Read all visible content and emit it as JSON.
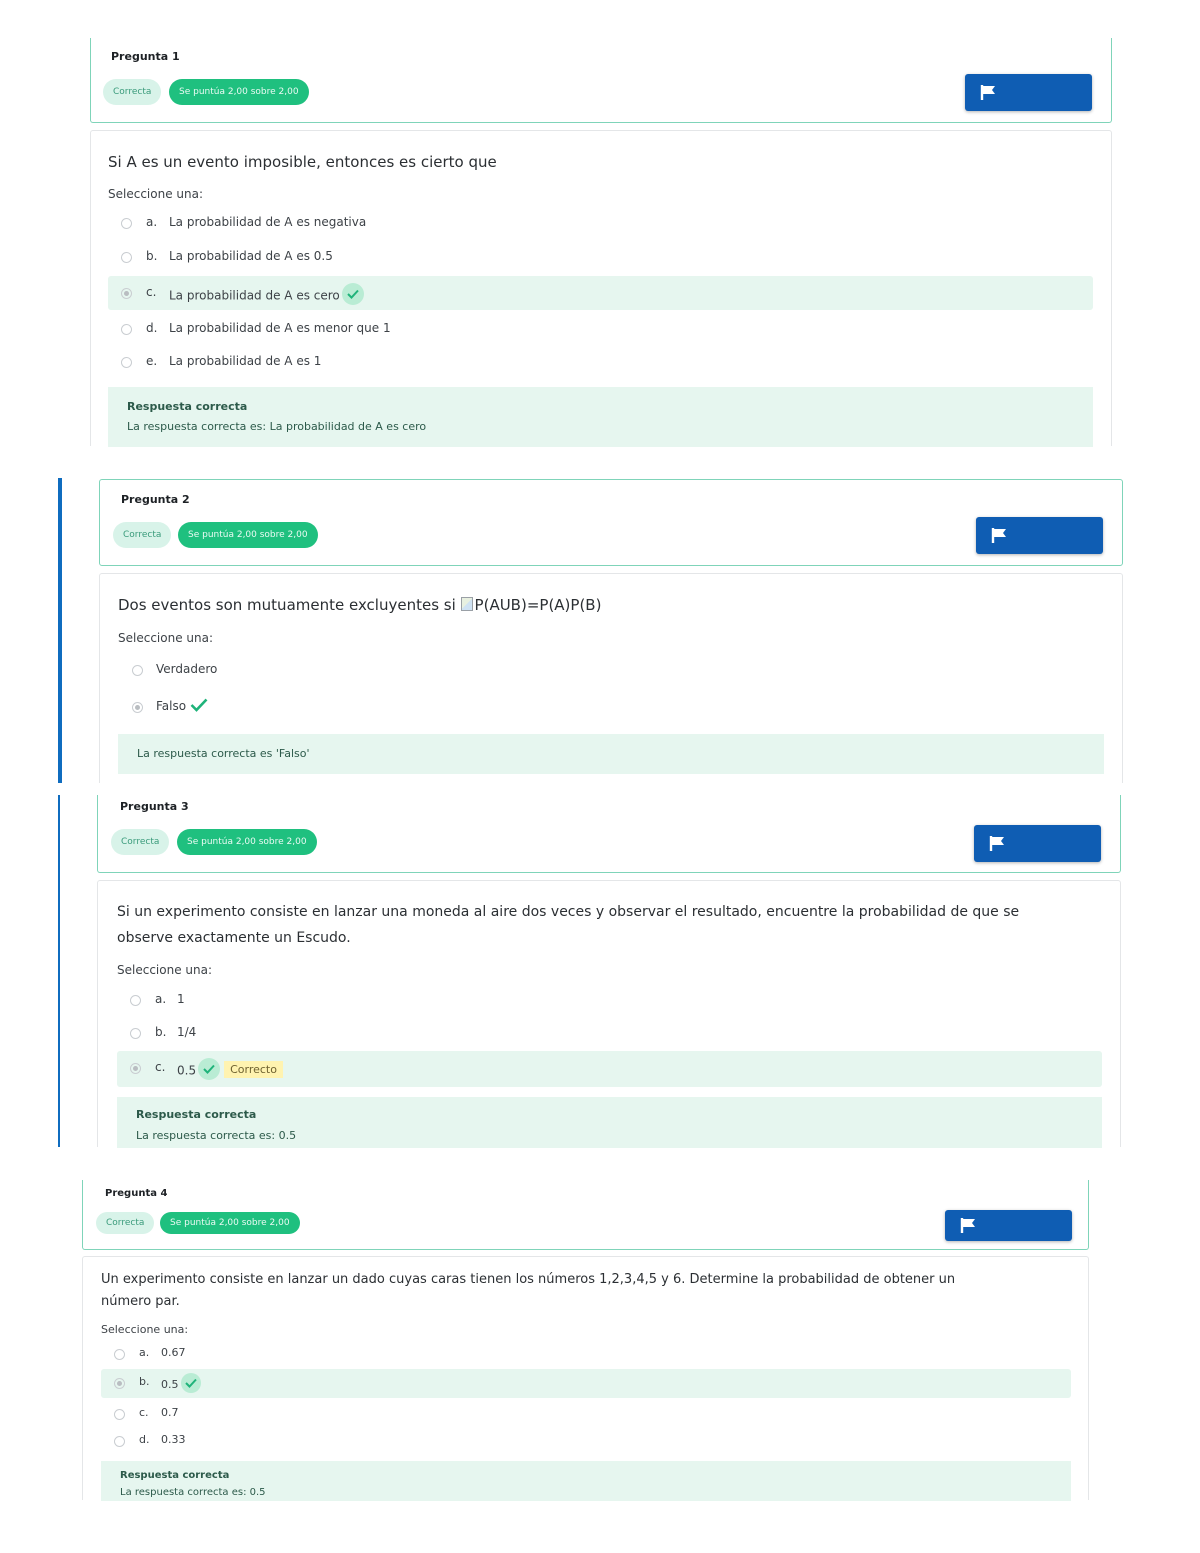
{
  "questions": [
    {
      "number_label": "Pregunta 1",
      "state": "Correcta",
      "grade": "Se puntúa 2,00 sobre 2,00",
      "text": "Si A es un evento imposible, entonces es cierto que",
      "prompt": "Seleccione una:",
      "options": [
        {
          "letter": "a.",
          "text": "La probabilidad de A es negativa"
        },
        {
          "letter": "b.",
          "text": "La probabilidad de A es 0.5"
        },
        {
          "letter": "c.",
          "text": "La probabilidad de A es cero"
        },
        {
          "letter": "d.",
          "text": "La probabilidad de A es menor que 1"
        },
        {
          "letter": "e.",
          "text": "La probabilidad de A es 1"
        }
      ],
      "selected_index": 2,
      "feedback_title": "Respuesta correcta",
      "feedback_text": "La respuesta correcta es: La probabilidad de A es cero"
    },
    {
      "number_label": "Pregunta 2",
      "state": "Correcta",
      "grade": "Se puntúa 2,00 sobre 2,00",
      "text_before": "Dos eventos son mutuamente excluyentes si ",
      "text_img_alt": "P(AUB)=P(A)P(B)",
      "prompt": "Seleccione una:",
      "options": [
        {
          "text": "Verdadero"
        },
        {
          "text": "Falso"
        }
      ],
      "selected_index": 1,
      "feedback_text": "La respuesta correcta es 'Falso'"
    },
    {
      "number_label": "Pregunta 3",
      "state": "Correcta",
      "grade": "Se puntúa 2,00 sobre 2,00",
      "text_line1": "Si un experimento consiste en lanzar una moneda al aire dos veces y observar el resultado, encuentre la probabilidad de que se",
      "text_line2": "observe exactamente un Escudo.",
      "prompt": "Seleccione una:",
      "options": [
        {
          "letter": "a.",
          "text": "1"
        },
        {
          "letter": "b.",
          "text": "1/4"
        },
        {
          "letter": "c.",
          "text": "0.5"
        }
      ],
      "selected_index": 2,
      "correct_tag": "Correcto",
      "feedback_title": "Respuesta correcta",
      "feedback_text": "La respuesta correcta es: 0.5"
    },
    {
      "number_label": "Pregunta 4",
      "state": "Correcta",
      "grade": "Se puntúa 2,00 sobre 2,00",
      "text_line1": "Un experimento consiste en lanzar un dado cuyas caras tienen los números 1,2,3,4,5 y 6. Determine la probabilidad de obtener un",
      "text_line2": "número par.",
      "prompt": "Seleccione una:",
      "options": [
        {
          "letter": "a.",
          "text": "0.67"
        },
        {
          "letter": "b.",
          "text": "0.5"
        },
        {
          "letter": "c.",
          "text": "0.7"
        },
        {
          "letter": "d.",
          "text": "0.33"
        }
      ],
      "selected_index": 1,
      "feedback_title": "Respuesta correcta",
      "feedback_text": "La respuesta correcta es: 0.5"
    }
  ],
  "icons": {
    "flag": "flag-icon",
    "check": "check-icon"
  },
  "colors": {
    "accent": "#0f6cbf",
    "flag_button": "#0f5db3",
    "grade_badge": "#1fc07f",
    "correct_bg": "#e6f6ef",
    "check": "#1fb37a"
  }
}
